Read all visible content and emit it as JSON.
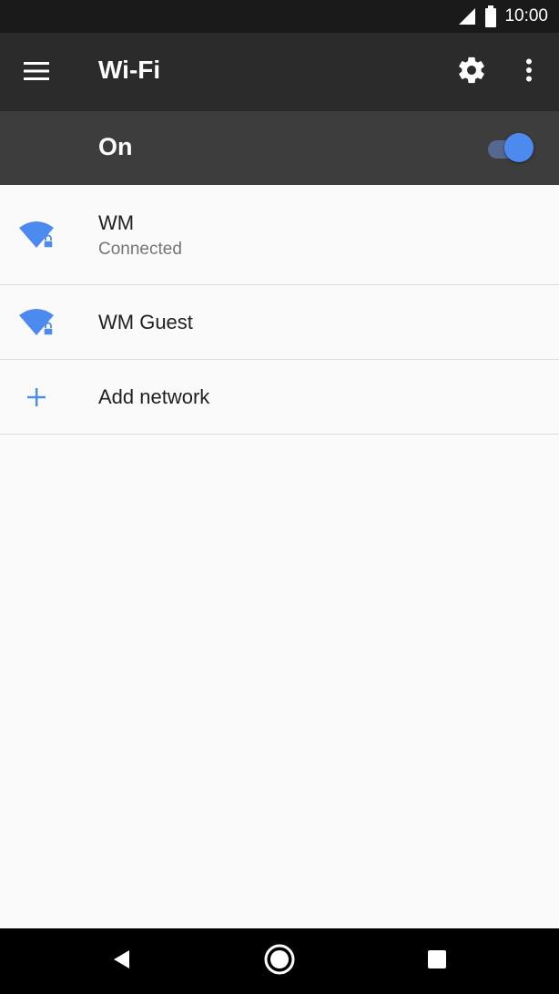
{
  "status_bar": {
    "time": "10:00",
    "icons": [
      "cell-signal-icon",
      "battery-icon"
    ]
  },
  "app_bar": {
    "title": "Wi-Fi",
    "icons": [
      "menu-icon",
      "gear-icon",
      "overflow-menu-icon"
    ]
  },
  "wifi_toggle": {
    "label": "On",
    "state": "on"
  },
  "networks": [
    {
      "name": "WM",
      "status": "Connected",
      "icon": "wifi-locked-icon"
    },
    {
      "name": "WM Guest",
      "icon": "wifi-locked-icon"
    }
  ],
  "add_network": {
    "label": "Add network",
    "icon": "plus-icon"
  },
  "nav_bar": {
    "icons": [
      "back-icon",
      "home-icon",
      "recents-icon"
    ]
  },
  "colors": {
    "accent": "#4d8af0",
    "app_bar": "#2b2b2b",
    "toggle_bar": "#3d3d3d",
    "status_bar": "#1a1a1a"
  }
}
